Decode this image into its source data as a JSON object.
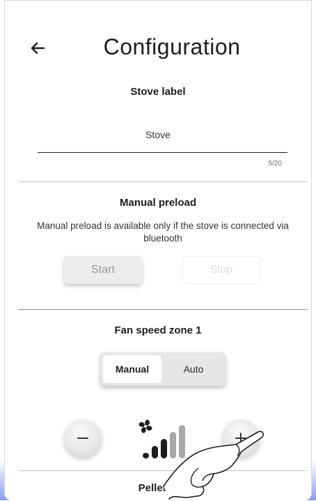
{
  "header": {
    "title": "Configuration",
    "back_icon": "arrow-left-icon"
  },
  "stove_label": {
    "title": "Stove label",
    "value": "Stove",
    "counter": "5/20"
  },
  "manual_preload": {
    "title": "Manual preload",
    "description": "Manual preload is available only if the stove is connected via bluetooth",
    "start_label": "Start",
    "stop_label": "Stop"
  },
  "fan_speed": {
    "title": "Fan speed zone 1",
    "options": [
      "Manual",
      "Auto"
    ],
    "selected": "Manual",
    "level": 2,
    "max_level": 5,
    "decrease_icon": "minus-icon",
    "increase_icon": "plus-icon",
    "fan_icon": "fan-icon"
  },
  "pellet_mode": {
    "title": "Pellet mo"
  },
  "overlay": {
    "icon": "pointing-hand-icon"
  },
  "colors": {
    "accent_bottom": "#8a9bf0",
    "level_on": "#1d1d1d",
    "level_off": "#a8a8a8"
  }
}
